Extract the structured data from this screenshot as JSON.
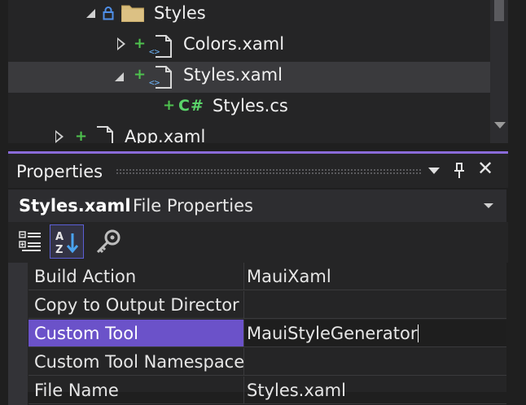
{
  "solution_explorer": {
    "items": [
      {
        "label": "Styles",
        "kind": "folder",
        "expanded": true,
        "locked": true
      },
      {
        "label": "Colors.xaml",
        "kind": "xaml-file",
        "expanded": false,
        "added": true
      },
      {
        "label": "Styles.xaml",
        "kind": "xaml-file",
        "expanded": true,
        "added": true,
        "selected": true
      },
      {
        "label": "Styles.cs",
        "kind": "csharp-file",
        "added": true,
        "icon_text": "C#"
      },
      {
        "label": "App.xaml",
        "kind": "xaml-file",
        "expanded": false,
        "added": true
      }
    ]
  },
  "properties_panel": {
    "title": "Properties",
    "close_glyph": "✕",
    "object_name": "Styles.xaml",
    "object_type": "File Properties",
    "toolbar": [
      "categorized-view-icon",
      "alphabetical-sort-icon",
      "property-pages-icon"
    ],
    "rows": [
      {
        "name": "Build Action",
        "value": "MauiXaml"
      },
      {
        "name": "Copy to Output Director",
        "value": ""
      },
      {
        "name": "Custom Tool",
        "value": "MauiStyleGenerator",
        "selected": true
      },
      {
        "name": "Custom Tool Namespace",
        "value": ""
      },
      {
        "name": "File Name",
        "value": "Styles.xaml"
      }
    ]
  },
  "colors": {
    "accent": "#8a6bd9",
    "selection": "#6b52c9",
    "added": "#4ec24e"
  }
}
